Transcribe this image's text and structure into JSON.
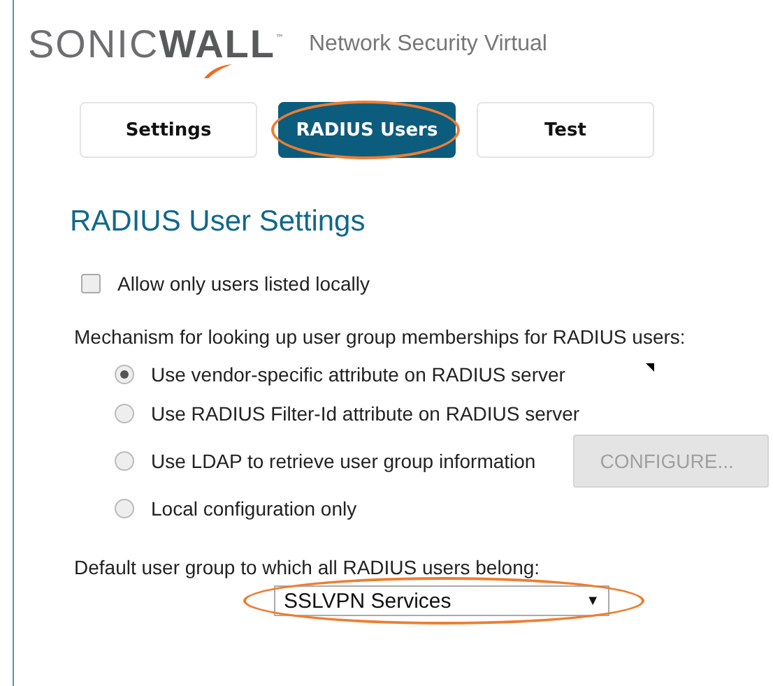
{
  "header": {
    "logo": "SONIC**WALL**",
    "trademark": "™",
    "product": "Network Security Virtual"
  },
  "tabs": [
    {
      "label": "Settings",
      "selected": false,
      "highlighted": false
    },
    {
      "label": "RADIUS Users",
      "selected": true,
      "highlighted": true
    },
    {
      "label": "Test",
      "selected": false,
      "highlighted": false
    }
  ],
  "title": "RADIUS User Settings",
  "allow_local": {
    "label": "Allow only users listed locally",
    "checked": false
  },
  "mechanism": {
    "label": "Mechanism for looking up user group memberships for RADIUS users:",
    "options": [
      {
        "label": "Use vendor-specific attribute on RADIUS server",
        "selected": true
      },
      {
        "label": "Use RADIUS Filter-Id attribute on RADIUS server",
        "selected": false
      },
      {
        "label": "Use LDAP to retrieve user group information",
        "selected": false,
        "button": {
          "label": "CONFIGURE...",
          "disabled": true
        }
      },
      {
        "label": "Local configuration only",
        "selected": false
      }
    ]
  },
  "default_group": {
    "label": "Default user group to which all RADIUS users belong:",
    "value": "SSLVPN Services",
    "arrow": "▼",
    "highlighted": true
  }
}
